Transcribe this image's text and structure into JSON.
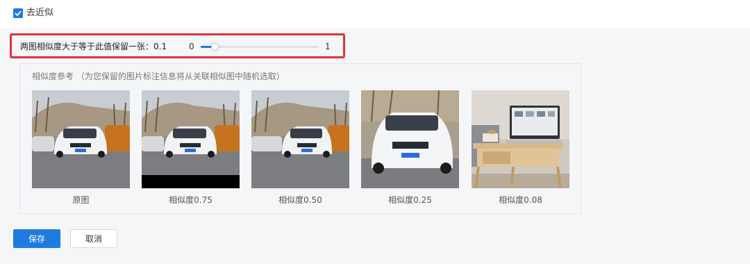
{
  "dedupe": {
    "label": "去近似",
    "checked": true
  },
  "slider": {
    "label": "两图相似度大于等于此值保留一张：0.1",
    "min_label": "0",
    "max_label": "1",
    "value": 0.1
  },
  "reference": {
    "title": "相似度参考 （为您保留的图片标注信息将从关联相似图中随机选取）",
    "items": [
      {
        "caption": "原图",
        "variant": "original"
      },
      {
        "caption": "相似度0.75",
        "variant": "cropped-bottom"
      },
      {
        "caption": "相似度0.50",
        "variant": "shifted"
      },
      {
        "caption": "相似度0.25",
        "variant": "zoomed"
      },
      {
        "caption": "相似度0.08",
        "variant": "laptop-desk"
      }
    ]
  },
  "actions": {
    "save_label": "保存",
    "cancel_label": "取消"
  },
  "colors": {
    "accent": "#1f7ae0",
    "highlight_border": "#e0303a"
  }
}
